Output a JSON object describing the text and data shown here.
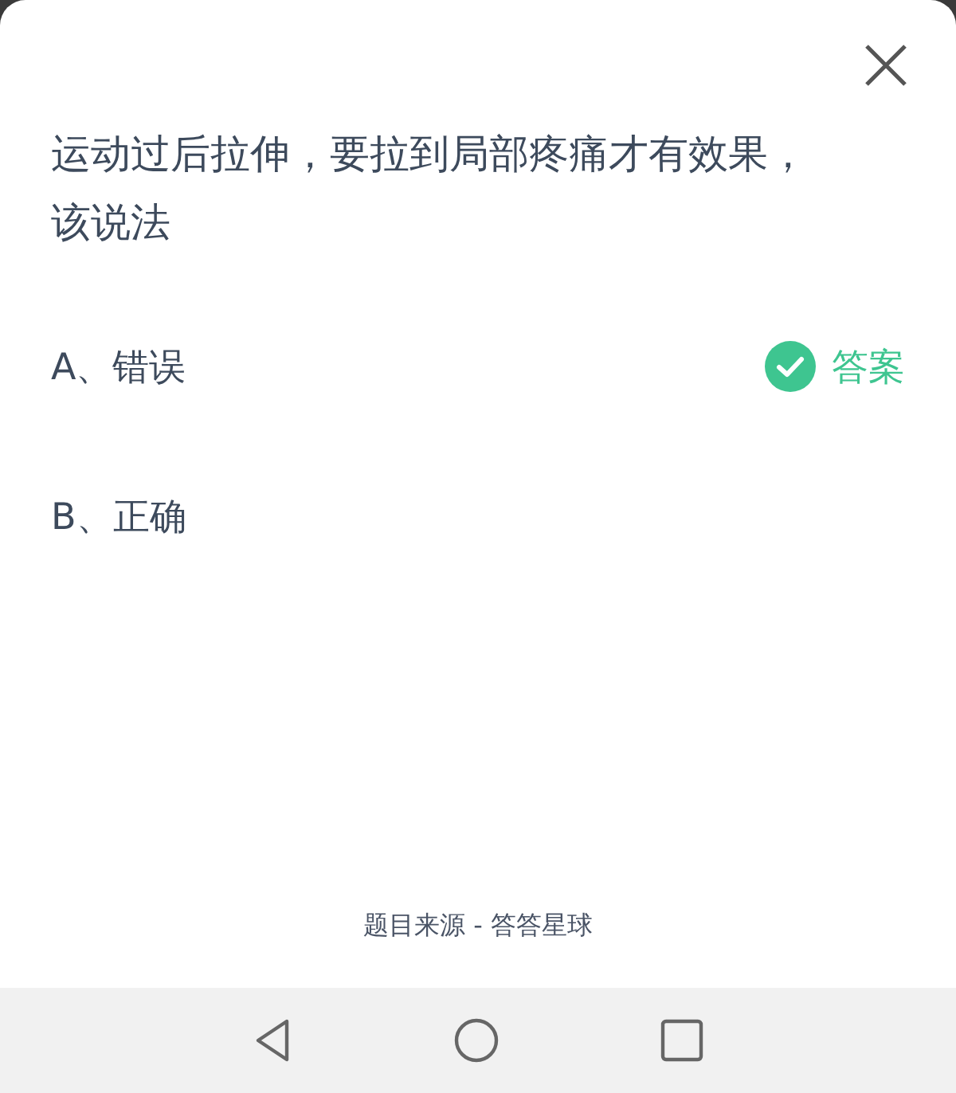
{
  "question": "运动过后拉伸，要拉到局部疼痛才有效果，该说法",
  "options": [
    {
      "label": "A、错误",
      "correct": true
    },
    {
      "label": "B、正确",
      "correct": false
    }
  ],
  "answer_label": "答案",
  "source": "题目来源 - 答答星球"
}
